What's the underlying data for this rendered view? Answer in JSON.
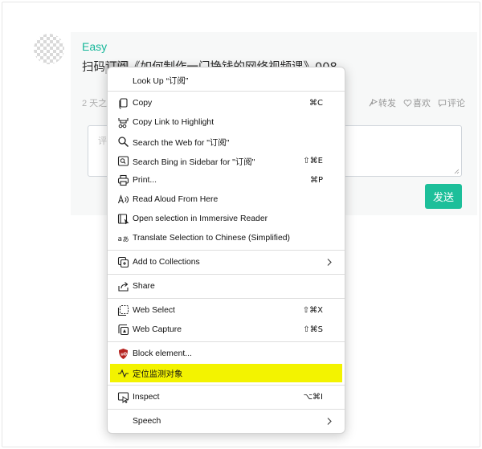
{
  "post": {
    "username": "Easy",
    "title_before": "扫码",
    "title_selected": "订阅",
    "title_after": "《如何制作一门挣钱的网络视频课》008",
    "time": "2 天之",
    "actions": {
      "share": "转发",
      "like": "喜欢",
      "comment": "评论"
    }
  },
  "comment": {
    "placeholder": "评",
    "send": "发送"
  },
  "menu": {
    "look_up": "Look Up “订阅”",
    "copy": "Copy",
    "copy_sc": "⌘C",
    "copy_link": "Copy Link to Highlight",
    "search_web": "Search the Web for \"订阅\"",
    "search_bing": "Search Bing in Sidebar for \"订阅\"",
    "search_bing_sc": "⇧⌘E",
    "print": "Print...",
    "print_sc": "⌘P",
    "read_aloud": "Read Aloud From Here",
    "immersive": "Open selection in Immersive Reader",
    "translate": "Translate Selection to Chinese (Simplified)",
    "collections": "Add to Collections",
    "share": "Share",
    "web_select": "Web Select",
    "web_select_sc": "⇧⌘X",
    "web_capture": "Web Capture",
    "web_capture_sc": "⇧⌘S",
    "block": "Block element...",
    "locate": "定位监测对象",
    "inspect": "Inspect",
    "inspect_sc": "⌥⌘I",
    "speech": "Speech"
  },
  "colors": {
    "accent": "#1dbf9a",
    "highlight": "#f3f300"
  }
}
